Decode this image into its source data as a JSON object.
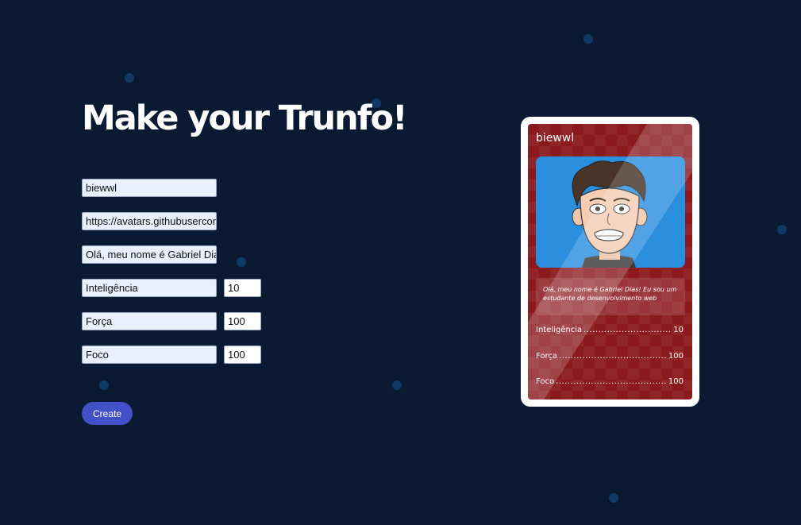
{
  "page": {
    "title": "Make your Trunfo!"
  },
  "form": {
    "name_value": "biewwl",
    "image_value": "https://avatars.githubusercontent.com",
    "description_value": "Olá, meu nome é Gabriel Dias! Eu sou um estudante de desenvolvimento web",
    "attributes": [
      {
        "label": "Inteligência",
        "value": "10"
      },
      {
        "label": "Força",
        "value": "100"
      },
      {
        "label": "Foco",
        "value": "100"
      }
    ],
    "create_label": "Create"
  },
  "card": {
    "name": "biewwl",
    "description": "Olá, meu nome é Gabriel Dias! Eu sou um estudante de desenvolvimento web",
    "attributes": [
      {
        "label": "Inteligência",
        "value": "10"
      },
      {
        "label": "Força",
        "value": "100"
      },
      {
        "label": "Foco",
        "value": "100"
      }
    ],
    "colors": {
      "background": "#8b1a1f",
      "image_bg": "#2b8fe0",
      "frame": "#ffffff"
    }
  },
  "colors": {
    "page_bg": "#0a1a33",
    "button": "#4450c8",
    "dot": "#0e3a63"
  }
}
